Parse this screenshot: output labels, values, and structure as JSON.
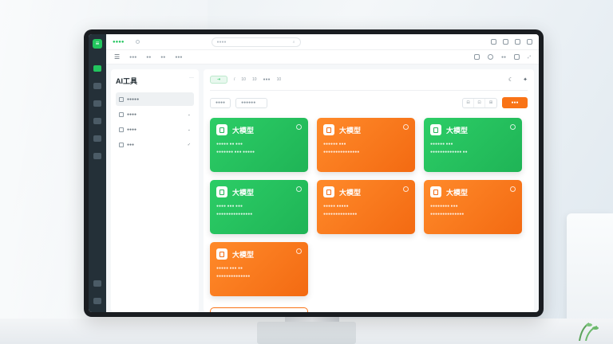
{
  "topbar": {
    "brand": "●●●●",
    "search_placeholder": "●●●●"
  },
  "subbar": {
    "crumbs": [
      "●●●",
      "●●",
      "●●",
      "●●●"
    ],
    "right_items": [
      "●●"
    ]
  },
  "panel": {
    "title": "AI工具",
    "more": "···",
    "items": [
      {
        "label": "●●●●●",
        "selected": true
      },
      {
        "label": "●●●●",
        "selected": false
      },
      {
        "label": "●●●●",
        "selected": false
      },
      {
        "label": "●●●",
        "selected": false
      }
    ]
  },
  "content": {
    "tab_active": "⇥",
    "tabs": [
      "/",
      "10",
      "10",
      "●●●",
      "10"
    ],
    "filters": [
      "●●●●",
      "●●●●●●"
    ],
    "segments": [
      "⊟",
      "⊡",
      "⊞"
    ],
    "primary_button": "●●●"
  },
  "cards": [
    {
      "title": "大模型",
      "color": "green",
      "line1": "●●●●● ●● ●●●",
      "line2": "●●●●●●● ●●● ●●●●●"
    },
    {
      "title": "大模型",
      "color": "orange",
      "line1": "●●●●●● ●●●",
      "line2": "●●●●●●●●●●●●●●●"
    },
    {
      "title": "大模型",
      "color": "green",
      "line1": "●●●●●● ●●●",
      "line2": "●●●●●●●●●●●●● ●●"
    },
    {
      "title": "大模型",
      "color": "green",
      "line1": "●●●● ●●● ●●●",
      "line2": "●●●●●●●●●●●●●●●"
    },
    {
      "title": "大模型",
      "color": "orange",
      "line1": "●●●●● ●●●●●",
      "line2": "●●●●●●●●●●●●●●"
    },
    {
      "title": "大模型",
      "color": "orange",
      "line1": "●●●●●●●● ●●●",
      "line2": "●●●●●●●●●●●●●●"
    },
    {
      "title": "大模型",
      "color": "orange",
      "line1": "●●●●● ●●● ●●",
      "line2": "●●●●●●●●●●●●●●"
    }
  ],
  "colors": {
    "green": "#22c55e",
    "orange": "#f97316",
    "rail": "#243038"
  }
}
